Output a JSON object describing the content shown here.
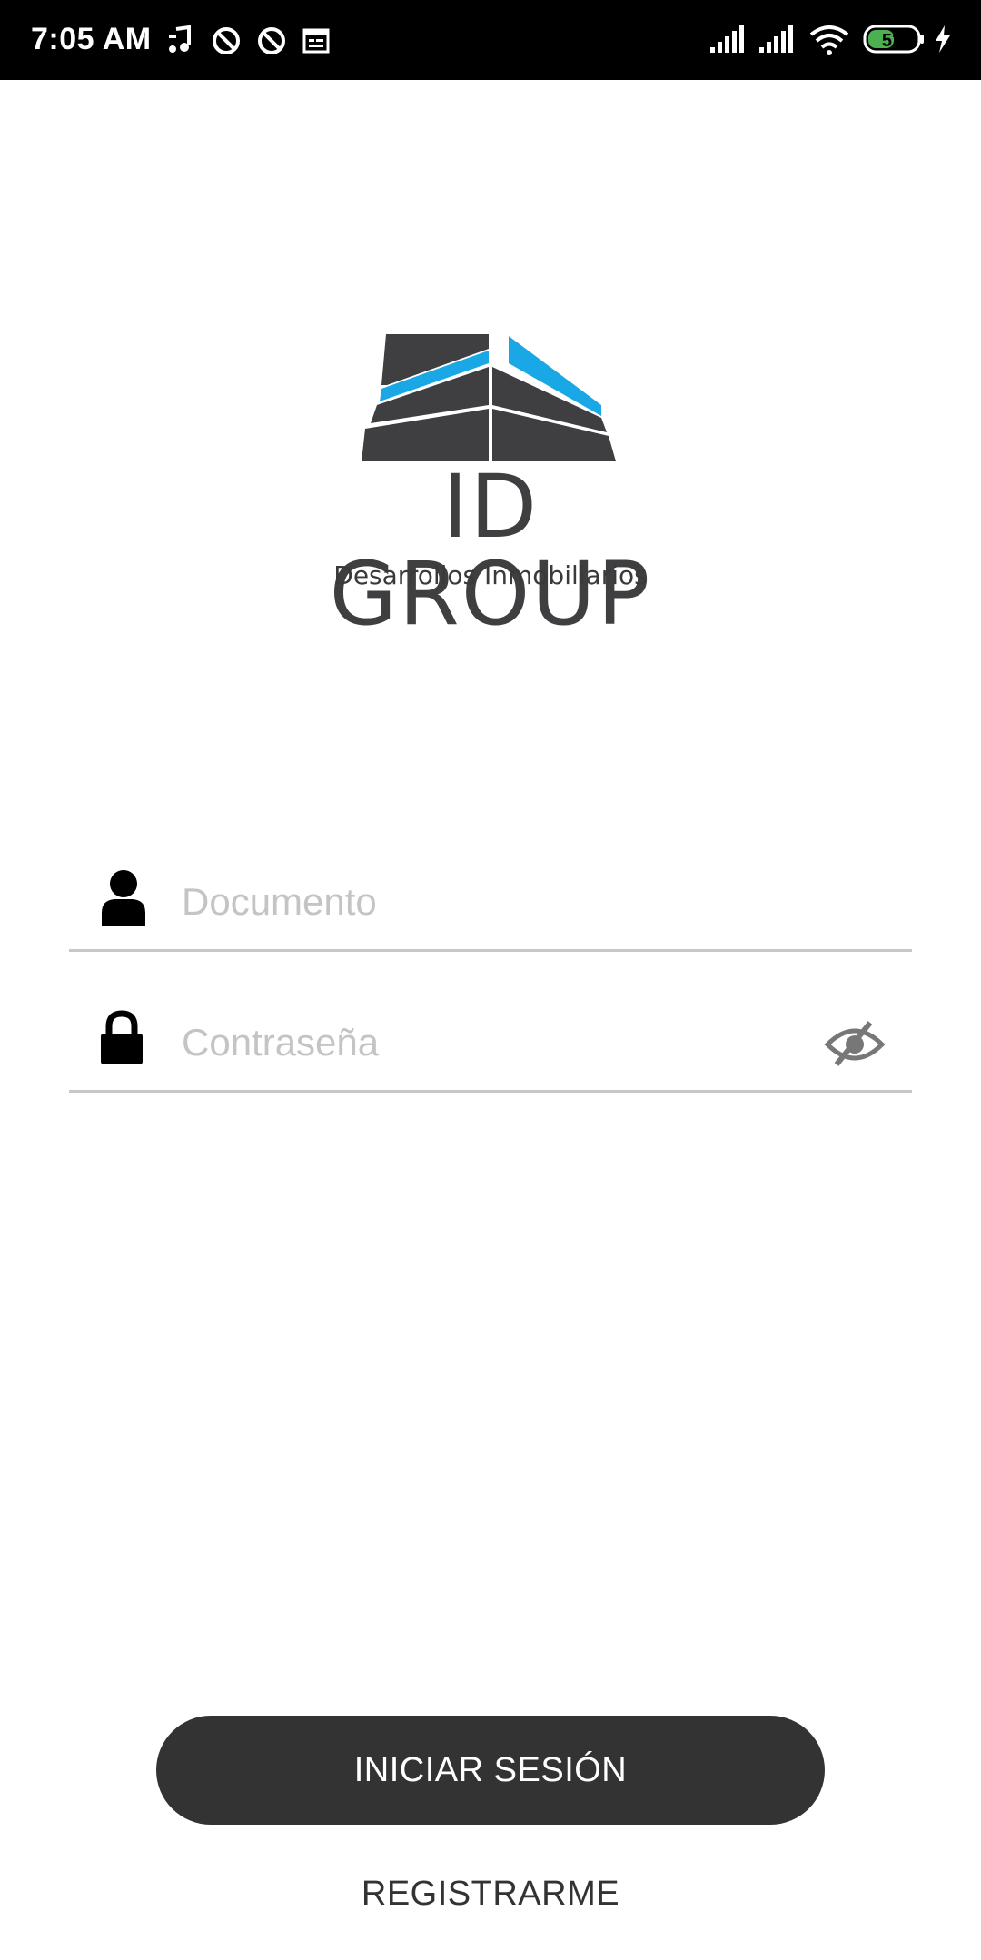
{
  "status_bar": {
    "time": "7:05 AM",
    "battery_level": "52",
    "icons_left": [
      "music-note-icon",
      "block-icon",
      "block-icon",
      "calendar-icon"
    ],
    "icons_right": [
      "signal-icon",
      "signal-icon",
      "wifi-icon",
      "battery-icon",
      "charging-icon"
    ]
  },
  "logo": {
    "title": "ID GROUP",
    "subtitle": "Desarrollos Inmobiliarios",
    "colors": {
      "dark": "#3f3f41",
      "accent": "#1aa7e6"
    }
  },
  "form": {
    "document": {
      "placeholder": "Documento",
      "value": ""
    },
    "password": {
      "placeholder": "Contraseña",
      "value": ""
    }
  },
  "actions": {
    "login_label": "INICIAR SESIÓN",
    "register_label": "REGISTRARME"
  },
  "colors": {
    "button_bg": "#333333",
    "divider": "#c8c8c8",
    "placeholder": "#c4c4c4"
  }
}
